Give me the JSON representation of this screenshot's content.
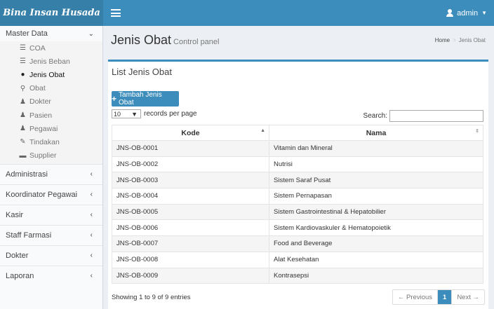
{
  "app": {
    "brand": "Bina Insan Husada",
    "user": "admin"
  },
  "sidebar": {
    "master": {
      "label": "Master Data"
    },
    "sub_items": [
      {
        "label": "COA",
        "icon": "list-icon",
        "glyph": "☰"
      },
      {
        "label": "Jenis Beban",
        "icon": "list-icon",
        "glyph": "☰"
      },
      {
        "label": "Jenis Obat",
        "icon": "pills-icon",
        "glyph": "●"
      },
      {
        "label": "Obat",
        "icon": "binoculars-icon",
        "glyph": "⚲"
      },
      {
        "label": "Dokter",
        "icon": "user-icon",
        "glyph": "♟"
      },
      {
        "label": "Pasien",
        "icon": "user-icon",
        "glyph": "♟"
      },
      {
        "label": "Pegawai",
        "icon": "user-icon",
        "glyph": "♟"
      },
      {
        "label": "Tindakan",
        "icon": "pencil-icon",
        "glyph": "✎"
      },
      {
        "label": "Supplier",
        "icon": "truck-icon",
        "glyph": "▬"
      }
    ],
    "menus": [
      {
        "label": "Administrasi"
      },
      {
        "label": "Koordinator Pegawai"
      },
      {
        "label": "Kasir"
      },
      {
        "label": "Staff Farmasi"
      },
      {
        "label": "Dokter"
      },
      {
        "label": "Laporan"
      }
    ]
  },
  "header": {
    "title": "Jenis Obat",
    "subtitle": "Control panel",
    "breadcrumb": {
      "home": "Home",
      "current": "Jenis Obat"
    }
  },
  "box": {
    "title": "List Jenis Obat",
    "add_label": "Tambah Jenis Obat",
    "page_size": "10",
    "page_size_suffix": "records per page",
    "search_label": "Search:",
    "search_value": ""
  },
  "table": {
    "headers": {
      "kode": "Kode",
      "nama": "Nama"
    },
    "rows": [
      {
        "kode": "JNS-OB-0001",
        "nama": "Vitamin dan Mineral"
      },
      {
        "kode": "JNS-OB-0002",
        "nama": "Nutrisi"
      },
      {
        "kode": "JNS-OB-0003",
        "nama": "Sistem Saraf Pusat"
      },
      {
        "kode": "JNS-OB-0004",
        "nama": "Sistem Pernapasan"
      },
      {
        "kode": "JNS-OB-0005",
        "nama": "Sistem Gastrointestinal & Hepatobilier"
      },
      {
        "kode": "JNS-OB-0006",
        "nama": "Sistem Kardiovaskuler & Hematopoietik"
      },
      {
        "kode": "JNS-OB-0007",
        "nama": "Food and Beverage"
      },
      {
        "kode": "JNS-OB-0008",
        "nama": "Alat Kesehatan"
      },
      {
        "kode": "JNS-OB-0009",
        "nama": "Kontrasepsi"
      }
    ]
  },
  "footer": {
    "info": "Showing 1 to 9 of 9 entries",
    "prev": "← Previous",
    "page": "1",
    "next": "Next →"
  },
  "colors": {
    "header": "#3c8dbc",
    "brand": "#367fa9",
    "content_bg": "#ecf0f5"
  }
}
